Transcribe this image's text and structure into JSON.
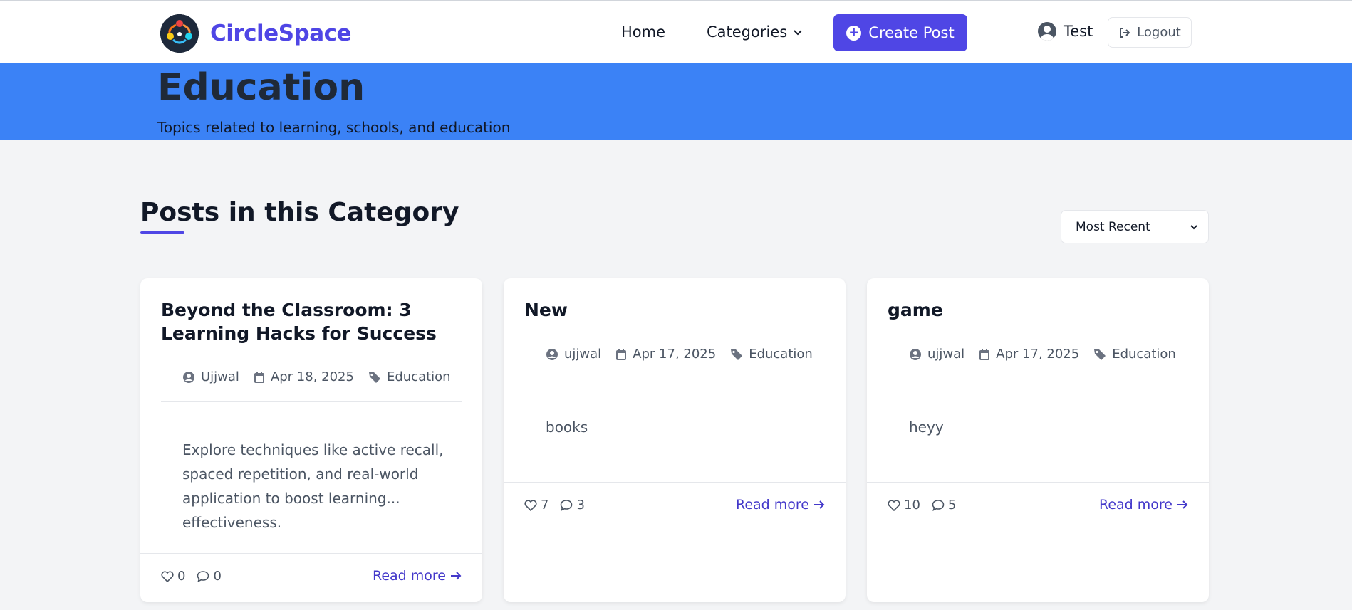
{
  "header": {
    "brand": "CircleSpace",
    "nav": {
      "home": "Home",
      "categories": "Categories"
    },
    "create_post": "Create Post",
    "user": "Test",
    "logout": "Logout"
  },
  "hero": {
    "title": "Education",
    "subtitle": "Topics related to learning, schools, and education"
  },
  "section": {
    "title": "Posts in this Category",
    "sort_selected": "Most Recent"
  },
  "posts": [
    {
      "title": "Beyond the Classroom: 3 Learning Hacks for Success",
      "author": "Ujjwal",
      "date": "Apr 18, 2025",
      "category": "Education",
      "excerpt": "Explore techniques like active recall, spaced repetition, and real-world application to boost learning... effectiveness.",
      "likes": "0",
      "comments": "0",
      "read_more": "Read more"
    },
    {
      "title": "New",
      "author": "ujjwal",
      "date": "Apr 17, 2025",
      "category": "Education",
      "excerpt": "books",
      "likes": "7",
      "comments": "3",
      "read_more": "Read more"
    },
    {
      "title": "game",
      "author": "ujjwal",
      "date": "Apr 17, 2025",
      "category": "Education",
      "excerpt": "heyy",
      "likes": "10",
      "comments": "5",
      "read_more": "Read more"
    }
  ],
  "colors": {
    "brand": "#4f46e5",
    "hero_bg": "#3b82f6",
    "page_bg": "#f3f4f6",
    "link": "#4338ca"
  },
  "icons": [
    "circlespace-logo",
    "chevron-down-icon",
    "plus-circle-icon",
    "user-circle-icon",
    "logout-icon",
    "user-icon",
    "calendar-icon",
    "tag-icon",
    "heart-icon",
    "comment-icon",
    "arrow-right-icon"
  ]
}
